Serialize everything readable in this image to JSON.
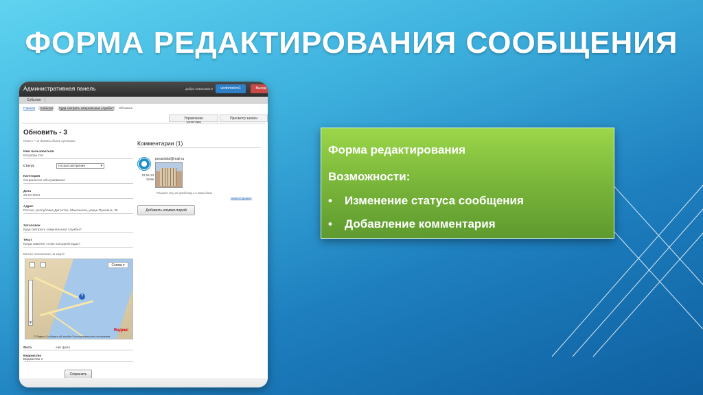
{
  "slide": {
    "title": "ФОРМА РЕДАКТИРОВАНИЯ СООБЩЕНИЯ"
  },
  "screenshot": {
    "topbar": {
      "title": "Административная панель",
      "welcome": "Добро пожаловать!",
      "user": "vedomstvo1",
      "exit": "Выход"
    },
    "menu": {
      "events": "События"
    },
    "breadcrumbs": {
      "home": "Главная",
      "events": "События",
      "message": "Куда смотрить комунальные службы?",
      "current": "Обновить"
    },
    "tabs": {
      "manage": "Управление записями",
      "view": "Просмотр записи"
    },
    "form": {
      "title": "Обновить - 3",
      "note": "Поля с * не должны быть пустыми.",
      "user_label": "Имя пользователя",
      "user_value": "Юсупова СМ",
      "status_label": "Статус",
      "status_value": "На рассмотрении",
      "category_label": "Категория",
      "category_value": "Социальное обслуживание",
      "date_label": "Дата",
      "date_value": "22.04.2013",
      "address_label": "Адрес",
      "address_value": "Россия, республика Дагестан, Махачкала, улица Пушкина, 25",
      "heading_label": "Заголовок",
      "heading_value": "Куда смотрить комунальные службы?",
      "text_label": "Текст",
      "text_value": "Когда заменят стояк холодной воды?",
      "map_label": "Место положение на карте",
      "map_scheme": "Схема",
      "map_brand": "Яндекс",
      "map_footer": "© Яндекс  Сообщить об ошибке  Пользовательское соглашение",
      "photo_label": "Фото",
      "photo_value": "Нет фото",
      "dept_label": "Ведомство",
      "dept_value": "Ведомство 1",
      "save": "Сохранить"
    },
    "comments": {
      "title": "Комментарии (1)",
      "author": "poramtdol@mail.ru",
      "date": "22.04.13",
      "time": "19:56",
      "text": "Решите эту же пробелму и в моем доме",
      "link": "комментировать",
      "add_button": "Добавить комментарий"
    }
  },
  "info": {
    "heading": "Форма редактирования",
    "subheading": "Возможности:",
    "bullet": "•",
    "items": [
      "Изменение статуса сообщения",
      "Добавление комментария"
    ]
  },
  "colors": {
    "background_top": "#5fd3ef",
    "background_bottom": "#0f5f9f",
    "info_box": "#7ab63a",
    "user_button": "#2f7fc8",
    "exit_button": "#c84a48"
  }
}
